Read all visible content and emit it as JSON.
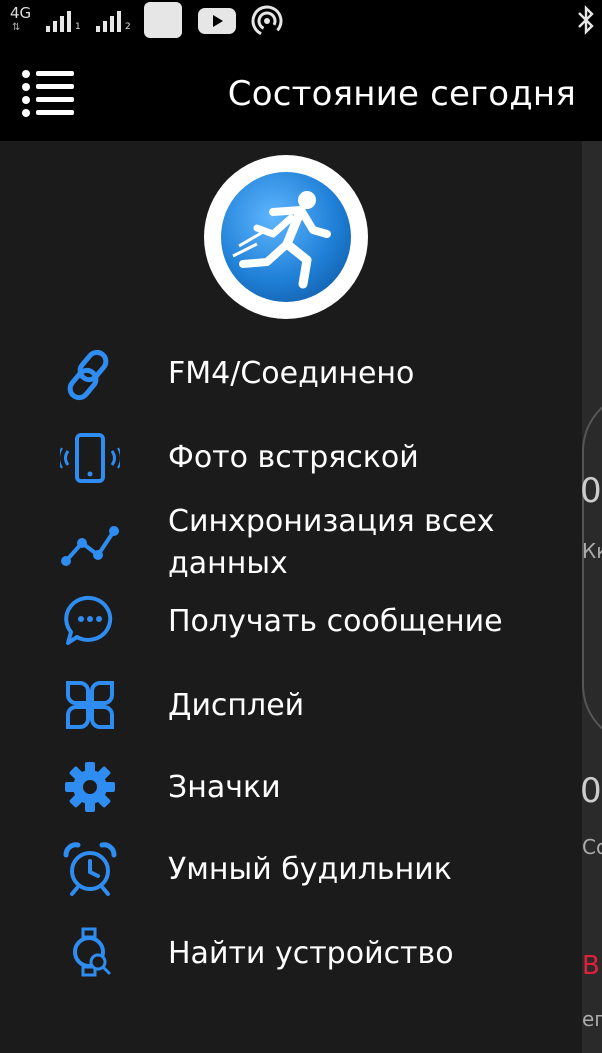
{
  "status_bar": {
    "network": "4G",
    "sim1": "1",
    "sim2": "2",
    "icons": [
      "youtube-icon",
      "hotspot-icon",
      "bluetooth-icon"
    ]
  },
  "app_bar": {
    "title": "Состояние сегодня",
    "menu_icon": "menu-icon"
  },
  "drawer": {
    "avatar_icon": "runner-icon",
    "items": [
      {
        "icon": "link-icon",
        "label": "FM4/Соединено"
      },
      {
        "icon": "phone-shake-icon",
        "label": "Фото встряской"
      },
      {
        "icon": "sync-graph-icon",
        "label_line1": "Синхронизация всех",
        "label_line2": "данных"
      },
      {
        "icon": "message-icon",
        "label": "Получать сообщение"
      },
      {
        "icon": "display-icon",
        "label": "Дисплей"
      },
      {
        "icon": "gear-icon",
        "label": "Значки"
      },
      {
        "icon": "alarm-clock-icon",
        "label": "Умный будильник"
      },
      {
        "icon": "find-device-icon",
        "label": "Найти устройство"
      }
    ]
  },
  "background_peek": {
    "texts": [
      "0",
      "Кк",
      "0",
      "Со",
      "В",
      "ег"
    ]
  },
  "colors": {
    "accent": "#2f8cf0",
    "bar": "#000000",
    "drawer_bg": "#1b1b1c"
  }
}
